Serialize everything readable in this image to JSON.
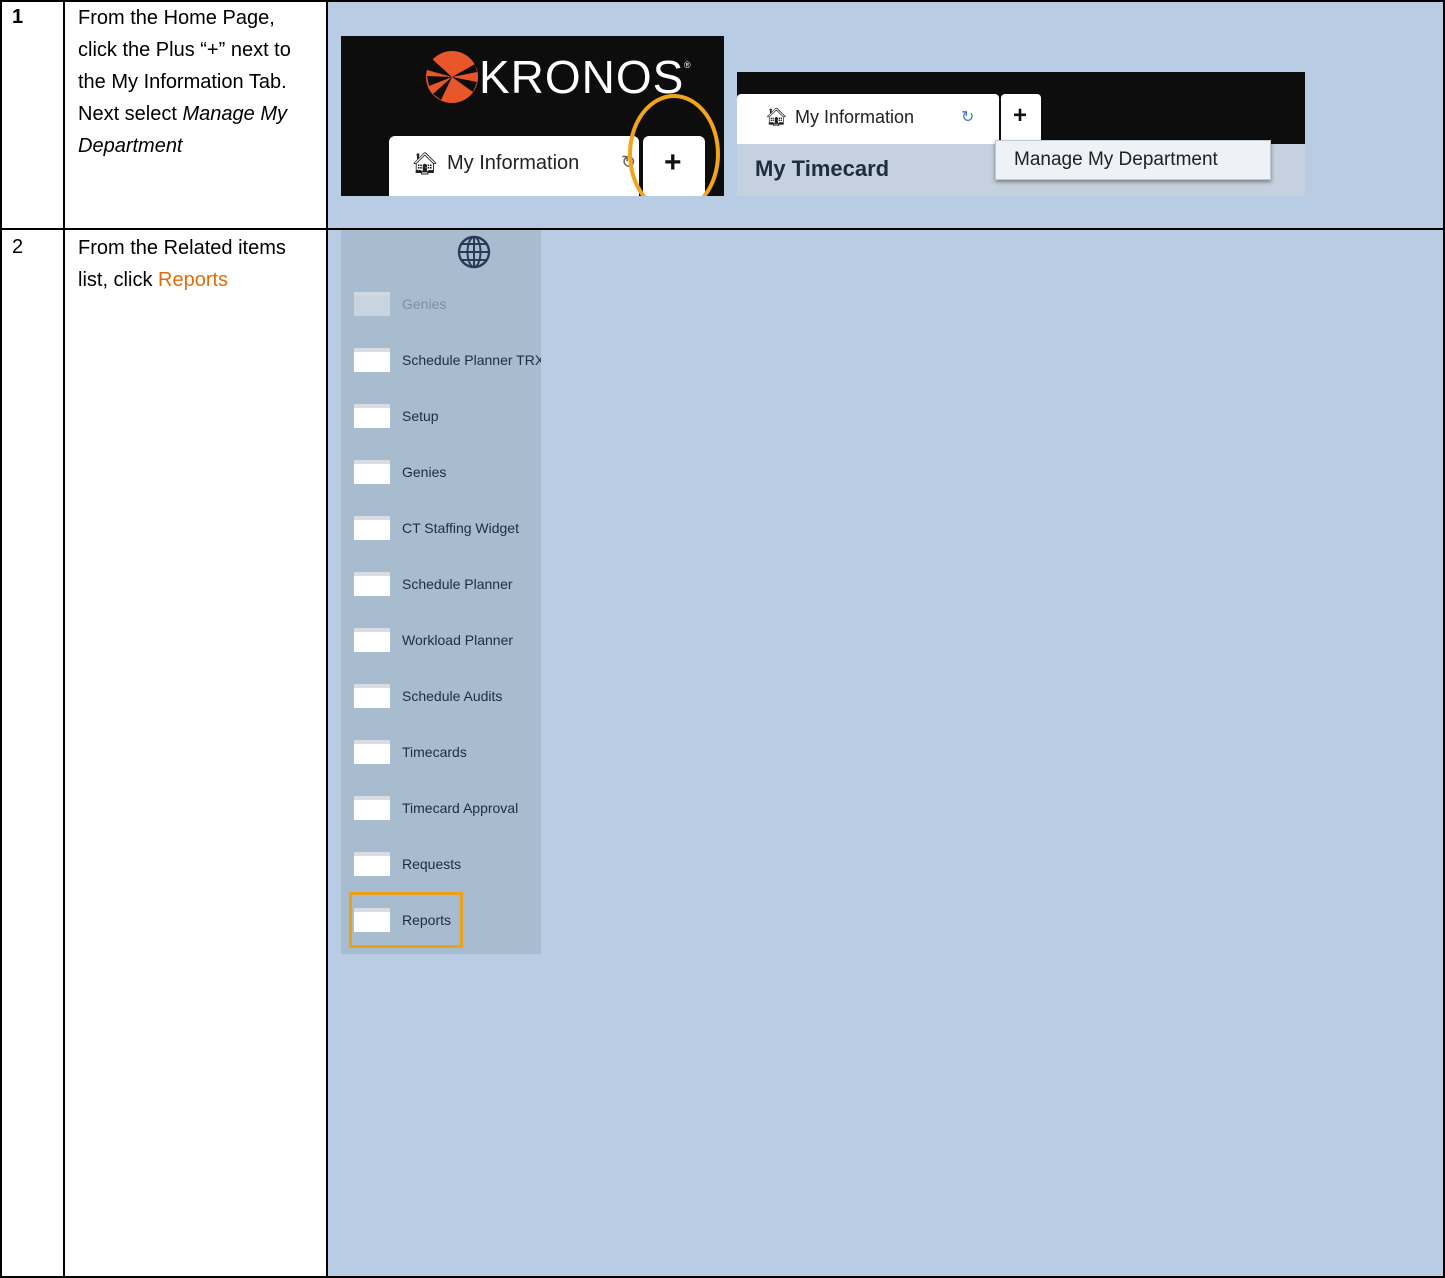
{
  "steps": [
    {
      "number": "1",
      "text_plain": "From the Home Page, click the Plus “+” next to the My Information Tab. Next select ",
      "text_italic": "Manage My Department"
    },
    {
      "number": "2",
      "text_plain": "From the Related items list, click ",
      "link": "Reports"
    }
  ],
  "screenshot_1a": {
    "logo_text": "KRONOS",
    "logo_mark": "®",
    "tab_label": "My Information",
    "plus_label": "+"
  },
  "screenshot_1b": {
    "tab_label": "My Information",
    "plus_label": "+",
    "page_title": "My Timecard",
    "menu_item": "Manage My Department"
  },
  "related_items": [
    "Genies",
    "Schedule Planner TRX",
    "Setup",
    "Genies",
    "CT Staffing Widget",
    "Schedule Planner",
    "Workload Planner",
    "Schedule Audits",
    "Timecards",
    "Timecard Approval",
    "Requests",
    "Reports"
  ],
  "colors": {
    "cell_bg": "#b8cce4",
    "highlight": "#f2a51a",
    "link": "#e36c0a"
  }
}
